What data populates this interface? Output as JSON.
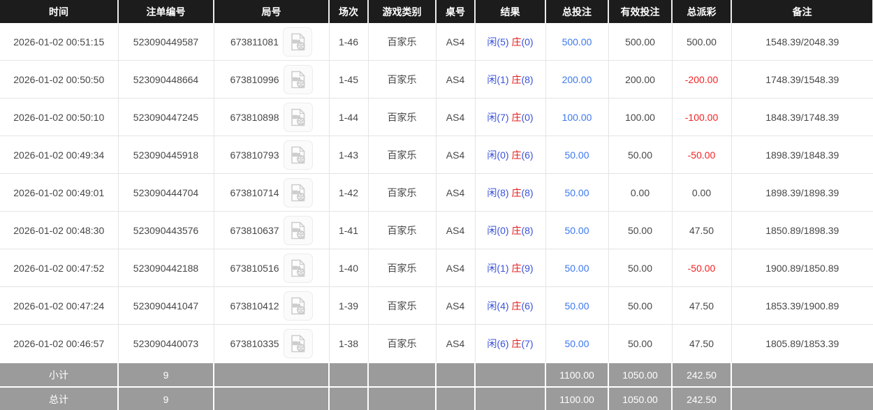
{
  "colors": {
    "header_bg": "#1c1c1c",
    "header_text": "#ffffff",
    "body_text": "#474747",
    "row_border": "#e4e4e4",
    "result_blue": "#3a52d9",
    "result_red": "#e31b1b",
    "amount_blue": "#3d79ef",
    "negative_red": "#f52222",
    "footer_bg": "#9b9b9b",
    "footer_text": "#ffffff"
  },
  "icons": {
    "video_icon": "video-file-with-reel"
  },
  "table": {
    "columns": [
      {
        "key": "time",
        "label": "时间"
      },
      {
        "key": "bet-id",
        "label": "注单编号"
      },
      {
        "key": "round",
        "label": "局号"
      },
      {
        "key": "session",
        "label": "场次"
      },
      {
        "key": "game-type",
        "label": "游戏类别"
      },
      {
        "key": "table-no",
        "label": "桌号"
      },
      {
        "key": "result",
        "label": "结果"
      },
      {
        "key": "total-bet",
        "label": "总投注"
      },
      {
        "key": "valid-bet",
        "label": "有效投注"
      },
      {
        "key": "payout",
        "label": "总派彩"
      },
      {
        "key": "remark",
        "label": "备注"
      }
    ],
    "rows": [
      {
        "time": "2026-01-02 00:51:15",
        "bet_id": "523090449587",
        "round": "673811081",
        "session": "1-46",
        "game_type": "百家乐",
        "table_no": "AS4",
        "result": {
          "player_text": "闲(5)",
          "banker_char": "庄",
          "banker_paren": "(0)"
        },
        "total_bet": "500.00",
        "valid_bet": "500.00",
        "payout": "500.00",
        "remark": "1548.39/2048.39"
      },
      {
        "time": "2026-01-02 00:50:50",
        "bet_id": "523090448664",
        "round": "673810996",
        "session": "1-45",
        "game_type": "百家乐",
        "table_no": "AS4",
        "result": {
          "player_text": "闲(1)",
          "banker_char": "庄",
          "banker_paren": "(8)"
        },
        "total_bet": "200.00",
        "valid_bet": "200.00",
        "payout": "-200.00",
        "remark": "1748.39/1548.39"
      },
      {
        "time": "2026-01-02 00:50:10",
        "bet_id": "523090447245",
        "round": "673810898",
        "session": "1-44",
        "game_type": "百家乐",
        "table_no": "AS4",
        "result": {
          "player_text": "闲(7)",
          "banker_char": "庄",
          "banker_paren": "(0)"
        },
        "total_bet": "100.00",
        "valid_bet": "100.00",
        "payout": "-100.00",
        "remark": "1848.39/1748.39"
      },
      {
        "time": "2026-01-02 00:49:34",
        "bet_id": "523090445918",
        "round": "673810793",
        "session": "1-43",
        "game_type": "百家乐",
        "table_no": "AS4",
        "result": {
          "player_text": "闲(0)",
          "banker_char": "庄",
          "banker_paren": "(6)"
        },
        "total_bet": "50.00",
        "valid_bet": "50.00",
        "payout": "-50.00",
        "remark": "1898.39/1848.39"
      },
      {
        "time": "2026-01-02 00:49:01",
        "bet_id": "523090444704",
        "round": "673810714",
        "session": "1-42",
        "game_type": "百家乐",
        "table_no": "AS4",
        "result": {
          "player_text": "闲(8)",
          "banker_char": "庄",
          "banker_paren": "(8)"
        },
        "total_bet": "50.00",
        "valid_bet": "0.00",
        "payout": "0.00",
        "remark": "1898.39/1898.39"
      },
      {
        "time": "2026-01-02 00:48:30",
        "bet_id": "523090443576",
        "round": "673810637",
        "session": "1-41",
        "game_type": "百家乐",
        "table_no": "AS4",
        "result": {
          "player_text": "闲(0)",
          "banker_char": "庄",
          "banker_paren": "(8)"
        },
        "total_bet": "50.00",
        "valid_bet": "50.00",
        "payout": "47.50",
        "remark": "1850.89/1898.39"
      },
      {
        "time": "2026-01-02 00:47:52",
        "bet_id": "523090442188",
        "round": "673810516",
        "session": "1-40",
        "game_type": "百家乐",
        "table_no": "AS4",
        "result": {
          "player_text": "闲(1)",
          "banker_char": "庄",
          "banker_paren": "(9)"
        },
        "total_bet": "50.00",
        "valid_bet": "50.00",
        "payout": "-50.00",
        "remark": "1900.89/1850.89"
      },
      {
        "time": "2026-01-02 00:47:24",
        "bet_id": "523090441047",
        "round": "673810412",
        "session": "1-39",
        "game_type": "百家乐",
        "table_no": "AS4",
        "result": {
          "player_text": "闲(4)",
          "banker_char": "庄",
          "banker_paren": "(6)"
        },
        "total_bet": "50.00",
        "valid_bet": "50.00",
        "payout": "47.50",
        "remark": "1853.39/1900.89"
      },
      {
        "time": "2026-01-02 00:46:57",
        "bet_id": "523090440073",
        "round": "673810335",
        "session": "1-38",
        "game_type": "百家乐",
        "table_no": "AS4",
        "result": {
          "player_text": "闲(6)",
          "banker_char": "庄",
          "banker_paren": "(7)"
        },
        "total_bet": "50.00",
        "valid_bet": "50.00",
        "payout": "47.50",
        "remark": "1805.89/1853.39"
      }
    ],
    "footer_rows": [
      {
        "label": "小计",
        "count": "9",
        "total_bet": "1100.00",
        "valid_bet": "1050.00",
        "payout": "242.50"
      },
      {
        "label": "总计",
        "count": "9",
        "total_bet": "1100.00",
        "valid_bet": "1050.00",
        "payout": "242.50"
      }
    ]
  }
}
